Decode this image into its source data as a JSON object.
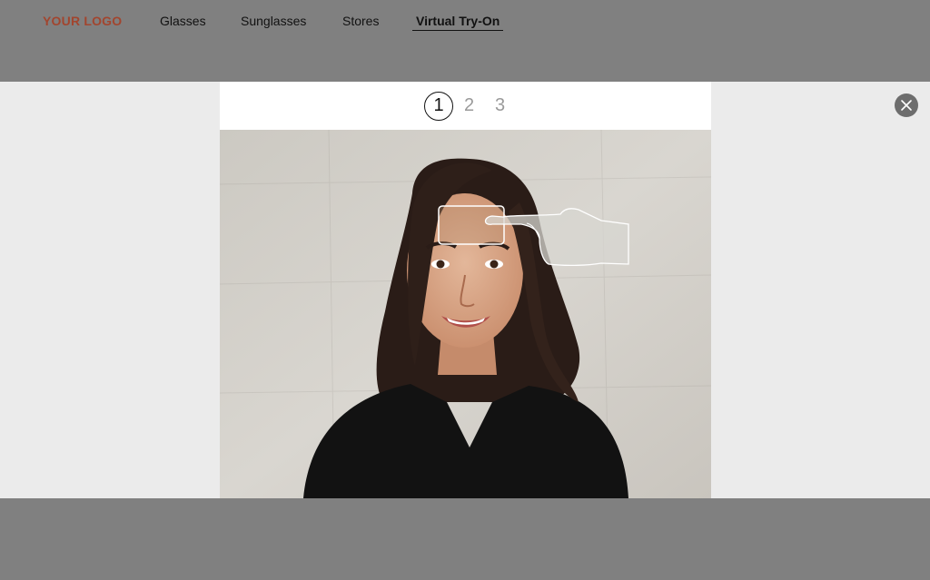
{
  "header": {
    "logo": "YOUR LOGO",
    "nav": [
      {
        "label": "Glasses"
      },
      {
        "label": "Sunglasses"
      },
      {
        "label": "Stores"
      },
      {
        "label": "Virtual Try-On",
        "active": true
      }
    ]
  },
  "tryon": {
    "steps": [
      "1",
      "2",
      "3"
    ],
    "current_step": 1,
    "instruction_icon": "hand-pointing-icon"
  },
  "colors": {
    "logo": "#a2452e",
    "backdrop": "#808080",
    "modal_surround": "#ebebeb",
    "close_button": "#6d6d6d"
  },
  "icons": {
    "close": "close-icon"
  }
}
